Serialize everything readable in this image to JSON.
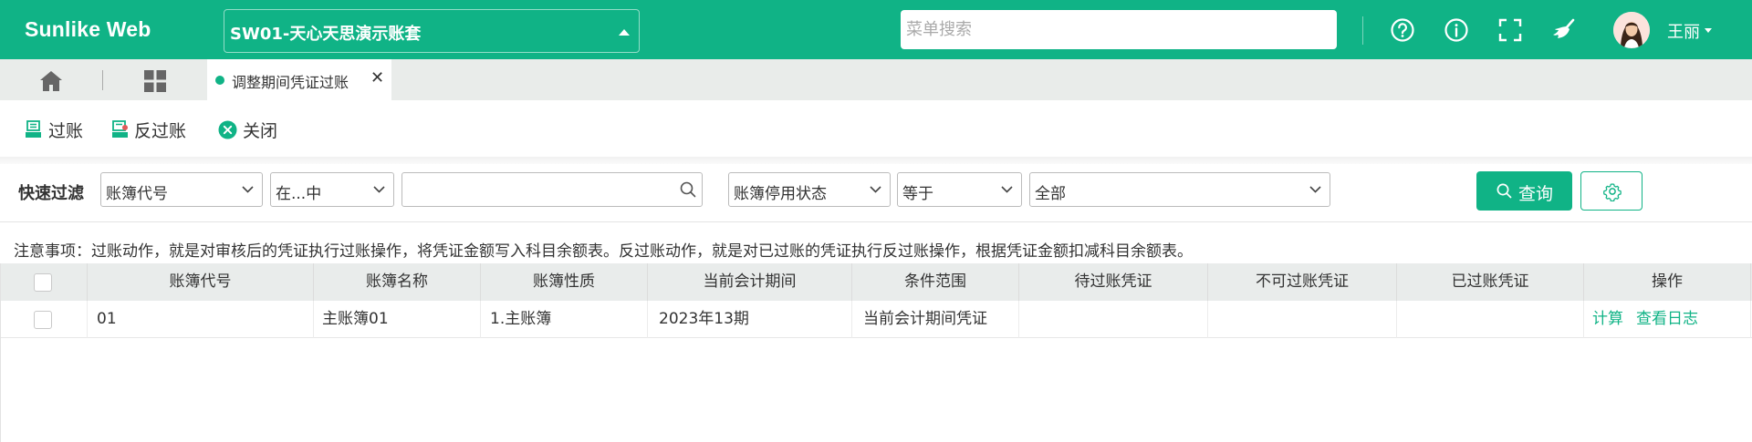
{
  "app": {
    "logo": "Sunlike Web"
  },
  "header": {
    "account_book": "SW01-天心天思演示账套",
    "menu_search_placeholder": "菜单搜索",
    "icons": [
      "help-circle-icon",
      "info-circle-icon",
      "fullscreen-icon",
      "clear-broom-icon"
    ],
    "user_name": "王丽"
  },
  "tabs": {
    "home_icon": "home-icon",
    "apps_icon": "grid-apps-icon",
    "active_tab": "调整期间凭证过账"
  },
  "toolbar": {
    "post_label": "过账",
    "unpost_label": "反过账",
    "close_label": "关闭"
  },
  "filter": {
    "label": "快速过滤",
    "field1": "账簿代号",
    "operator1": "在...中",
    "value1": "",
    "field2": "账簿停用状态",
    "operator2": "等于",
    "value2": "全部",
    "query_label": "查询"
  },
  "notice": "注意事项：过账动作，就是对审核后的凭证执行过账操作，将凭证金额写入科目余额表。反过账动作，就是对已过账的凭证执行反过账操作，根据凭证金额扣减科目余额表。",
  "table": {
    "columns": [
      "账簿代号",
      "账簿名称",
      "账簿性质",
      "当前会计期间",
      "条件范围",
      "待过账凭证",
      "不可过账凭证",
      "已过账凭证",
      "操作"
    ],
    "rows": [
      {
        "code": "01",
        "name": "主账簿01",
        "nature": "1.主账簿",
        "period": "2023年13期",
        "scope": "当前会计期间凭证",
        "pending": "",
        "unpostable": "",
        "posted": "",
        "actions": [
          "计算",
          "查看日志"
        ]
      }
    ]
  },
  "colors": {
    "brand": "#10b386",
    "tabbar": "#e9ecea",
    "table_header": "#e9eceb"
  }
}
